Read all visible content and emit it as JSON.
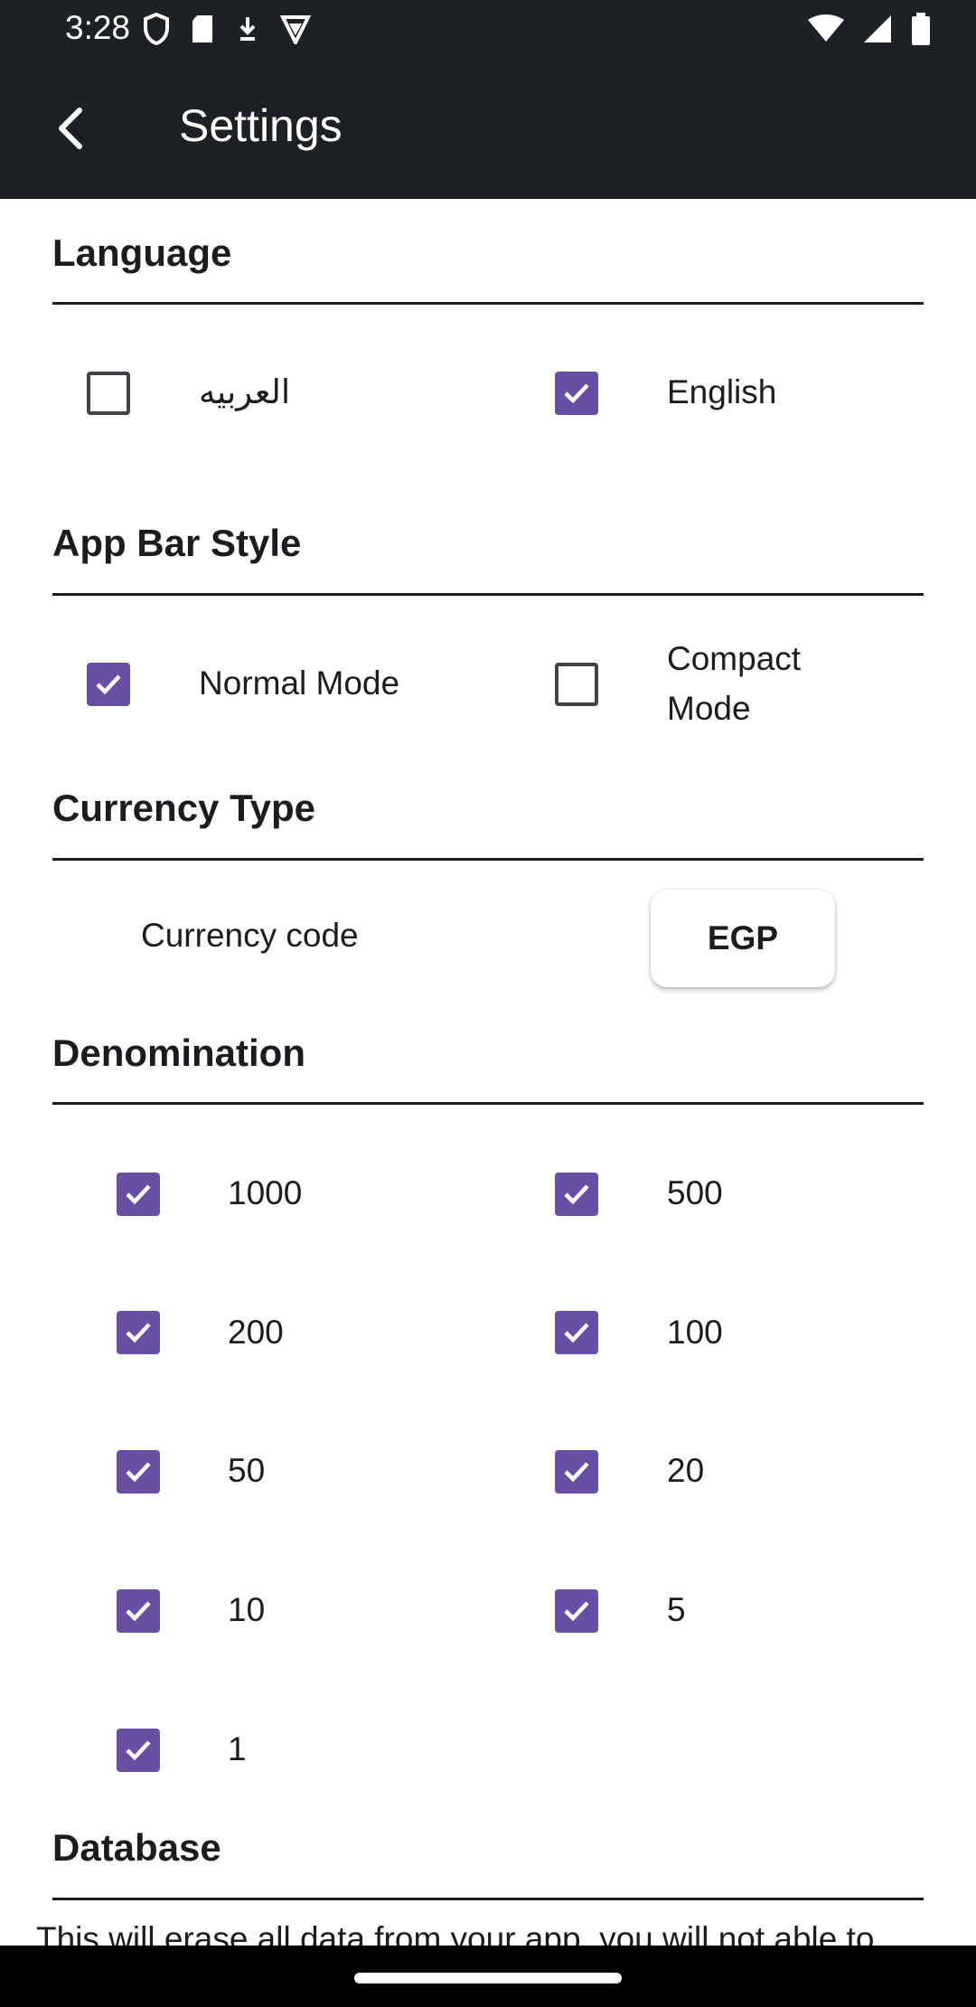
{
  "status_bar": {
    "time": "3:28",
    "left_icons": [
      "shield-icon",
      "sd-card-icon",
      "download-icon",
      "vpn-icon"
    ],
    "right_icons": [
      "wifi-icon",
      "signal-icon",
      "battery-icon"
    ]
  },
  "app_bar": {
    "title": "Settings",
    "back_icon": "chevron-left-icon"
  },
  "language": {
    "title": "Language",
    "options": [
      {
        "label": "العربيه",
        "checked": false
      },
      {
        "label": "English",
        "checked": true
      }
    ]
  },
  "app_bar_style": {
    "title": "App Bar Style",
    "options": [
      {
        "label": "Normal Mode",
        "checked": true
      },
      {
        "label_line1": "Compact",
        "label_line2": "Mode",
        "checked": false
      }
    ]
  },
  "currency": {
    "title": "Currency Type",
    "label": "Currency code",
    "value": "EGP"
  },
  "denomination": {
    "title": "Denomination",
    "items": [
      {
        "label": "1000",
        "checked": true
      },
      {
        "label": "500",
        "checked": true
      },
      {
        "label": "200",
        "checked": true
      },
      {
        "label": "100",
        "checked": true
      },
      {
        "label": "50",
        "checked": true
      },
      {
        "label": "20",
        "checked": true
      },
      {
        "label": "10",
        "checked": true
      },
      {
        "label": "5",
        "checked": true
      },
      {
        "label": "1",
        "checked": true
      }
    ]
  },
  "database": {
    "title": "Database",
    "text": "This will erase all data from your app, you will not able to"
  },
  "colors": {
    "accent": "#6750a4",
    "app_bar": "#1e2124"
  }
}
